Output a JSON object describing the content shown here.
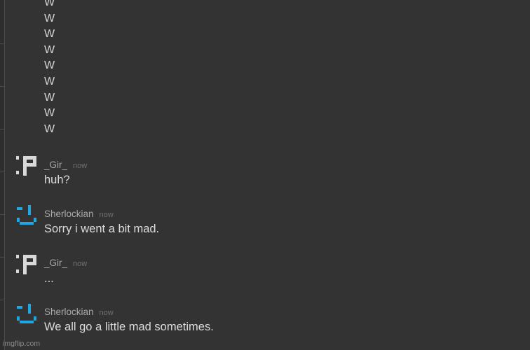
{
  "scroll_lines": [
    "W",
    "W",
    "W",
    "W",
    "W",
    "W",
    "W",
    "W",
    "W"
  ],
  "messages": [
    {
      "author": "_Gir_",
      "time": "now",
      "text": "huh?",
      "avatar_icon": "pixel-colon-p-face-icon",
      "avatar_color": "#d9d9d9"
    },
    {
      "author": "Sherlockian",
      "time": "now",
      "text": "Sorry i went a bit mad.",
      "avatar_icon": "pixel-smiley-face-icon",
      "avatar_color": "#1ea7e1"
    },
    {
      "author": "_Gir_",
      "time": "now",
      "text": "...",
      "avatar_icon": "pixel-colon-p-face-icon",
      "avatar_color": "#d9d9d9"
    },
    {
      "author": "Sherlockian",
      "time": "now",
      "text": "We all go a little mad sometimes.",
      "avatar_icon": "pixel-smiley-face-icon",
      "avatar_color": "#1ea7e1"
    }
  ],
  "watermark": "imgflip.com",
  "colors": {
    "background": "#333333",
    "text": "#dcdcdc",
    "author": "#a9a9a9",
    "timestamp": "#707070"
  }
}
